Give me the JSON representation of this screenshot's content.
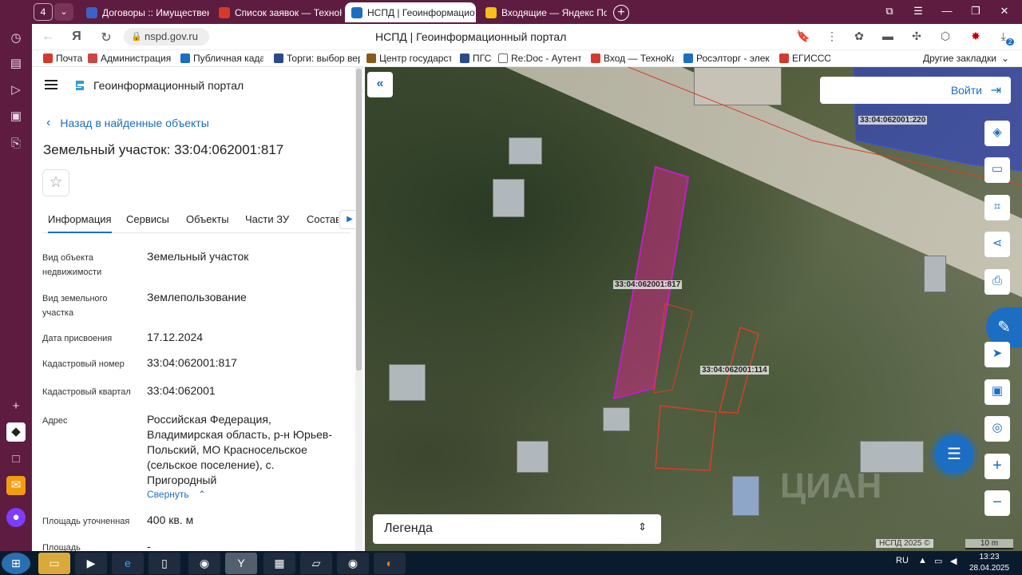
{
  "browser": {
    "tab_counter": "4",
    "tabs": [
      {
        "title": "Договоры :: Имуществен",
        "favicon_color": "#3b62c7"
      },
      {
        "title": "Список заявок — ТехноК",
        "favicon_color": "#d33a2c"
      },
      {
        "title": "НСПД | Геоинформацио",
        "favicon_color": "#1b6ec2"
      },
      {
        "title": "Входящие — Яндекс Почт",
        "favicon_color": "#f5c01a"
      }
    ],
    "url": "nspd.gov.ru",
    "page_title": "НСПД | Геоинформационный портал",
    "bookmarks": [
      "Почта",
      "Администрация м",
      "Публичная кадас",
      "Торги: выбор вер",
      "Центр государств",
      "ПГС",
      "Re:Doc - Аутентис",
      "Вход — ТехноКад",
      "Росэлторг - элект",
      "ЕГИССО"
    ],
    "other_bookmarks": "Другие закладки",
    "download_badge": "2"
  },
  "panel": {
    "portal_name": "Геоинформационный портал",
    "back_link": "Назад в найденные объекты",
    "title": "Земельный участок: 33:04:062001:817",
    "tabs": [
      "Информация",
      "Сервисы",
      "Объекты",
      "Части ЗУ",
      "Состав"
    ],
    "fields": [
      {
        "label": "Вид объекта недвижимости",
        "value": "Земельный участок"
      },
      {
        "label": "Вид земельного участка",
        "value": "Землепользование"
      },
      {
        "label": "Дата присвоения",
        "value": "17.12.2024"
      },
      {
        "label": "Кадастровый номер",
        "value": "33:04:062001:817"
      },
      {
        "label": "Кадастровый квартал",
        "value": "33:04:062001"
      },
      {
        "label": "Адрес",
        "value": "Российская Федерация, Владимирская область, р-н Юрьев-Польский, МО Красносельское (сельское поселение), с. Пригородный"
      },
      {
        "label": "Площадь уточненная",
        "value": "400 кв. м"
      },
      {
        "label": "Площадь",
        "value": "-"
      }
    ],
    "collapse_link": "Свернуть"
  },
  "map": {
    "login": "Войти",
    "parcel_labels": [
      "33:04:062001:220",
      "33:04:062001:817",
      "33:04:062001:114"
    ],
    "legend": "Легенда",
    "copyright": "НСПД 2025 ©",
    "scale": "10 m",
    "watermark": "ЦИАН"
  },
  "taskbar": {
    "lang": "RU",
    "time": "13:23",
    "date": "28.04.2025"
  }
}
